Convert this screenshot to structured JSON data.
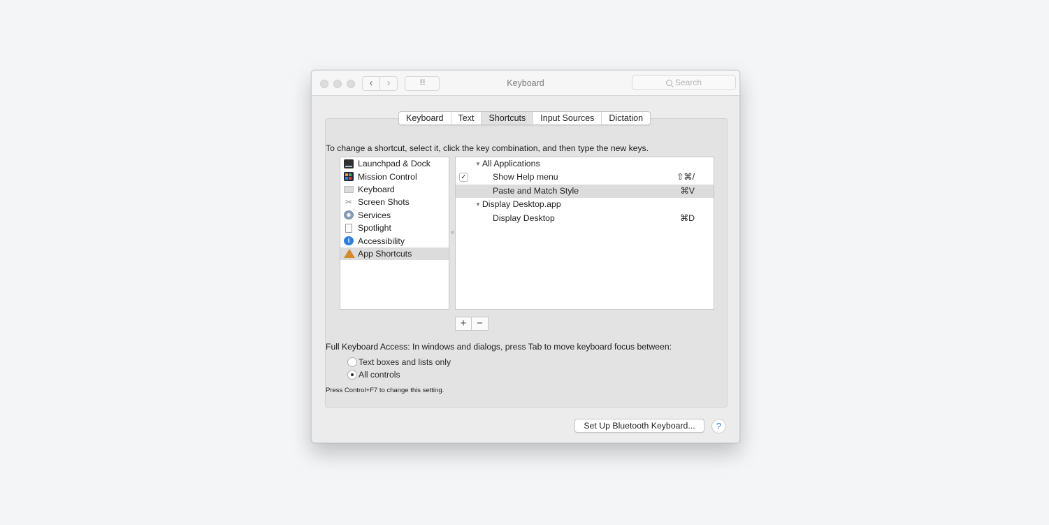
{
  "window": {
    "title": "Keyboard",
    "search_placeholder": "Search",
    "nav": {
      "back_icon": "chevron-left",
      "forward_icon": "chevron-right",
      "grid_icon": "grid-dots"
    }
  },
  "tabs": [
    {
      "label": "Keyboard",
      "active": false
    },
    {
      "label": "Text",
      "active": false
    },
    {
      "label": "Shortcuts",
      "active": true
    },
    {
      "label": "Input Sources",
      "active": false
    },
    {
      "label": "Dictation",
      "active": false
    }
  ],
  "instructions": "To change a shortcut, select it, click the key combination, and then type the new keys.",
  "categories": [
    {
      "label": "Launchpad & Dock",
      "icon": "launchpad-dock-icon"
    },
    {
      "label": "Mission Control",
      "icon": "mission-control-icon"
    },
    {
      "label": "Keyboard",
      "icon": "keyboard-icon"
    },
    {
      "label": "Screen Shots",
      "icon": "screenshot-icon"
    },
    {
      "label": "Services",
      "icon": "services-gear-icon"
    },
    {
      "label": "Spotlight",
      "icon": "spotlight-icon"
    },
    {
      "label": "Accessibility",
      "icon": "accessibility-icon"
    },
    {
      "label": "App Shortcuts",
      "icon": "app-shortcuts-icon",
      "selected": true
    }
  ],
  "shortcuts": [
    {
      "type": "group",
      "label": "All Applications"
    },
    {
      "type": "item",
      "label": "Show Help menu",
      "keys": "⇧⌘/",
      "checked": true
    },
    {
      "type": "item",
      "label": "Paste and Match Style",
      "keys": "⌘V",
      "selected": true
    },
    {
      "type": "group",
      "label": "Display Desktop.app"
    },
    {
      "type": "item",
      "label": "Display Desktop",
      "keys": "⌘D"
    }
  ],
  "add_label": "+",
  "remove_label": "−",
  "full_keyboard_access": {
    "label": "Full Keyboard Access: In windows and dialogs, press Tab to move keyboard focus between:",
    "options": [
      {
        "label": "Text boxes and lists only",
        "selected": false
      },
      {
        "label": "All controls",
        "selected": true
      }
    ],
    "hint": "Press Control+F7 to change this setting."
  },
  "bluetooth_button": "Set Up Bluetooth Keyboard...",
  "help_label": "?"
}
